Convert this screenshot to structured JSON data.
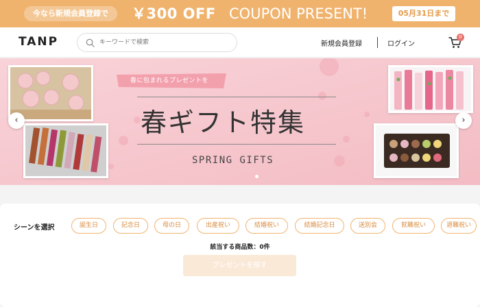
{
  "coupon": {
    "pill": "今なら新規会員登録で",
    "amount": "￥300 OFF",
    "text": "COUPON PRESENT!",
    "deadline": "05月31日まで",
    "color": "#f0b36e"
  },
  "header": {
    "logo": "TANP",
    "search_placeholder": "キーワードで検索",
    "signup": "新規会員登録",
    "login": "ログイン",
    "cart_count": "0"
  },
  "banner": {
    "badge": "春に包まれるプレゼントを",
    "title": "春ギフト特集",
    "subtitle": "SPRING GIFTS",
    "prev_icon": "‹",
    "next_icon": "›"
  },
  "scene": {
    "label": "シーンを選択",
    "chips": [
      "誕生日",
      "記念日",
      "母の日",
      "出産祝い",
      "結婚祝い",
      "結婚記念日",
      "送別会",
      "就職祝い",
      "退職祝い"
    ],
    "count_text": "該当する商品数：0件",
    "button": "プレゼントを探す"
  }
}
